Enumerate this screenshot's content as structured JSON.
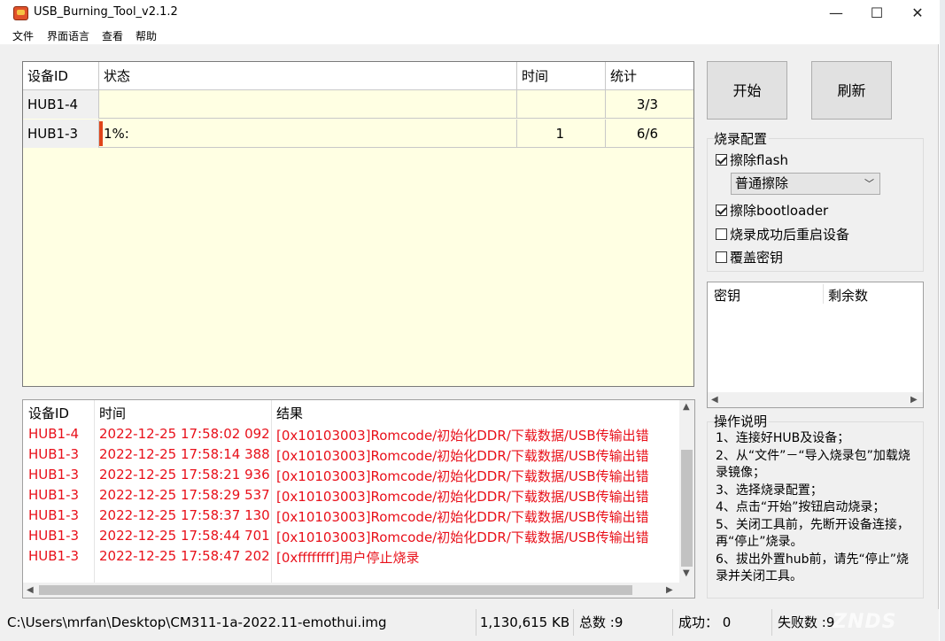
{
  "window": {
    "title": "USB_Burning_Tool_v2.1.2",
    "minimize_glyph": "—",
    "maximize_glyph": "☐",
    "close_glyph": "✕"
  },
  "menu": [
    "文件",
    "界面语言",
    "查看",
    "帮助"
  ],
  "device_table": {
    "headers": [
      "设备ID",
      "状态",
      "时间",
      "统计"
    ],
    "rows": [
      {
        "id": "HUB1-4",
        "state": "",
        "time": "",
        "stat": "3/3"
      },
      {
        "id": "HUB1-3",
        "state": "1%:",
        "time": "1",
        "stat": "6/6"
      }
    ]
  },
  "log_table": {
    "headers": [
      "设备ID",
      "时间",
      "结果"
    ],
    "rows": [
      {
        "id": "HUB1-4",
        "time": "2022-12-25 17:58:02 092",
        "result": "[0x10103003]Romcode/初始化DDR/下载数据/USB传输出错"
      },
      {
        "id": "HUB1-3",
        "time": "2022-12-25 17:58:14 388",
        "result": "[0x10103003]Romcode/初始化DDR/下载数据/USB传输出错"
      },
      {
        "id": "HUB1-3",
        "time": "2022-12-25 17:58:21 936",
        "result": "[0x10103003]Romcode/初始化DDR/下载数据/USB传输出错"
      },
      {
        "id": "HUB1-3",
        "time": "2022-12-25 17:58:29 537",
        "result": "[0x10103003]Romcode/初始化DDR/下载数据/USB传输出错"
      },
      {
        "id": "HUB1-3",
        "time": "2022-12-25 17:58:37 130",
        "result": "[0x10103003]Romcode/初始化DDR/下载数据/USB传输出错"
      },
      {
        "id": "HUB1-3",
        "time": "2022-12-25 17:58:44 701",
        "result": "[0x10103003]Romcode/初始化DDR/下载数据/USB传输出错"
      },
      {
        "id": "HUB1-3",
        "time": "2022-12-25 17:58:47 202",
        "result": "[0xffffffff]用户停止烧录"
      }
    ]
  },
  "buttons": {
    "start": "开始",
    "refresh": "刷新"
  },
  "burn_config": {
    "title": "烧录配置",
    "erase_flash": {
      "label": "擦除flash",
      "checked": true
    },
    "erase_mode": "普通擦除",
    "erase_bootloader": {
      "label": "擦除bootloader",
      "checked": true
    },
    "reboot_after": {
      "label": "烧录成功后重启设备",
      "checked": false
    },
    "overwrite_key": {
      "label": "覆盖密钥",
      "checked": false
    }
  },
  "key_table": {
    "headers": [
      "密钥",
      "剩余数"
    ]
  },
  "instructions": {
    "title": "操作说明",
    "lines": [
      "1、连接好HUB及设备；",
      "2、从“文件”－“导入烧录包”加载烧录镜像；",
      "3、选择烧录配置；",
      "4、点击“开始”按钮启动烧录；",
      "5、关闭工具前，先断开设备连接，再“停止”烧录。",
      "6、拔出外置hub前，请先“停止”烧录并关闭工具。"
    ]
  },
  "status_bar": {
    "path": "C:\\Users\\mrfan\\Desktop\\CM311-1a-2022.11-emothui.img",
    "size": "1,130,615 KB",
    "total": "总数 :9",
    "success": "成功： 0",
    "failed": "失败数 :9"
  },
  "watermark": "ZNDS",
  "colors": {
    "log_error": "#e8101a",
    "table_bg": "#ffffe3",
    "progress": "#e0451a"
  }
}
